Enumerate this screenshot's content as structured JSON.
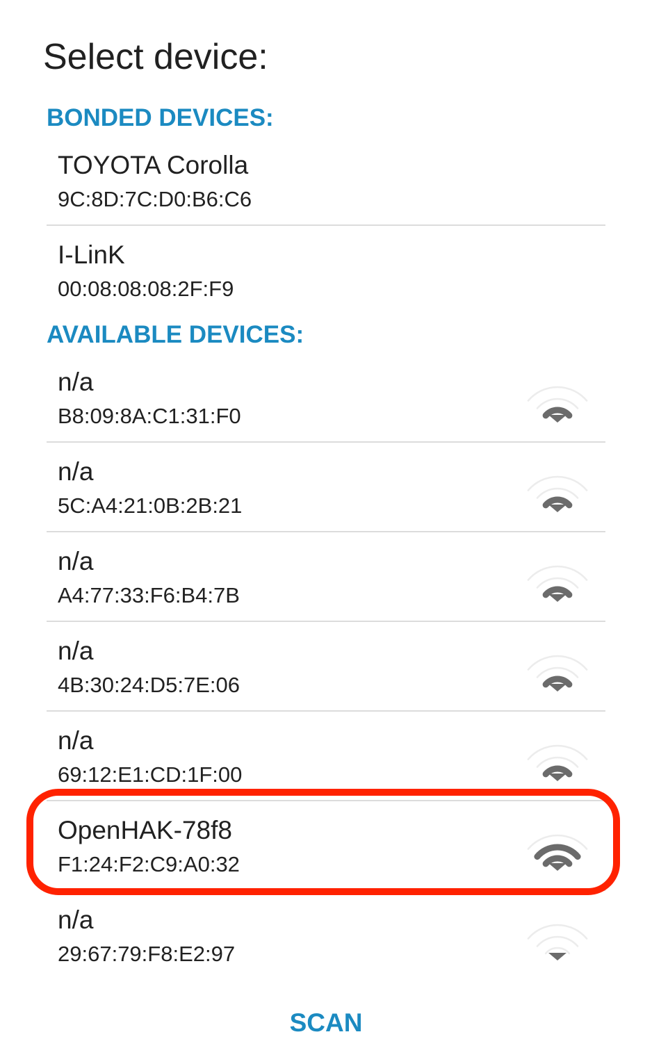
{
  "dialog": {
    "title": "Select device:"
  },
  "bonded": {
    "header": "BONDED DEVICES:",
    "devices": [
      {
        "name": "TOYOTA Corolla",
        "address": "9C:8D:7C:D0:B6:C6"
      },
      {
        "name": "I-LinK",
        "address": "00:08:08:08:2F:F9"
      }
    ]
  },
  "available": {
    "header": "AVAILABLE DEVICES:",
    "devices": [
      {
        "name": "n/a",
        "address": "B8:09:8A:C1:31:F0",
        "signal_bars": 2
      },
      {
        "name": "n/a",
        "address": "5C:A4:21:0B:2B:21",
        "signal_bars": 2
      },
      {
        "name": "n/a",
        "address": "A4:77:33:F6:B4:7B",
        "signal_bars": 2
      },
      {
        "name": "n/a",
        "address": "4B:30:24:D5:7E:06",
        "signal_bars": 2
      },
      {
        "name": "n/a",
        "address": "69:12:E1:CD:1F:00",
        "signal_bars": 2
      },
      {
        "name": "OpenHAK-78f8",
        "address": "F1:24:F2:C9:A0:32",
        "signal_bars": 3
      },
      {
        "name": "n/a",
        "address": "29:67:79:F8:E2:97",
        "signal_bars": 1
      }
    ]
  },
  "actions": {
    "scan_label": "SCAN"
  },
  "icons": {
    "signal": "wifi-signal-icon"
  },
  "colors": {
    "accent": "#1b8ac1",
    "highlight": "#ff2200",
    "signal_active": "#6b6b6b",
    "signal_inactive": "#ececec"
  }
}
